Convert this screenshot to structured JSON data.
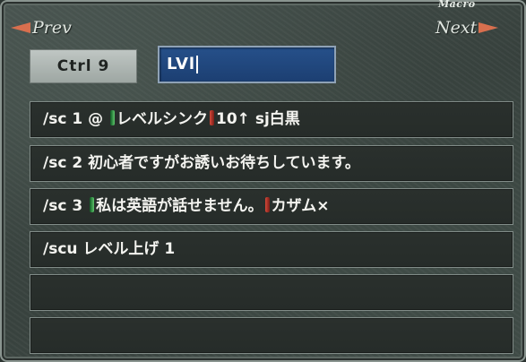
{
  "header": {
    "title": "Macro",
    "prev_label": "Prev",
    "next_label": "Next"
  },
  "macro_set": {
    "ctrl_label": "Ctrl 9",
    "name_value": "LVl"
  },
  "lines": [
    {
      "prefix": "/sc 1 @ ",
      "tab1": "レベルシンク",
      "suffix": "10↑ sj白黒"
    },
    {
      "text": "/sc 2 初心者ですがお誘いお待ちしています。"
    },
    {
      "prefix": "/sc 3 ",
      "tab1": "私は英語が話せません。",
      "suffix": "カザム×"
    },
    {
      "text": "/scu レベル上げ 1"
    },
    {
      "text": ""
    },
    {
      "text": ""
    }
  ],
  "colors": {
    "arrow": "#d86f4e",
    "name_field_bg": "#26508a",
    "tab_open": "#5ec56b",
    "tab_close": "#d4493a"
  }
}
